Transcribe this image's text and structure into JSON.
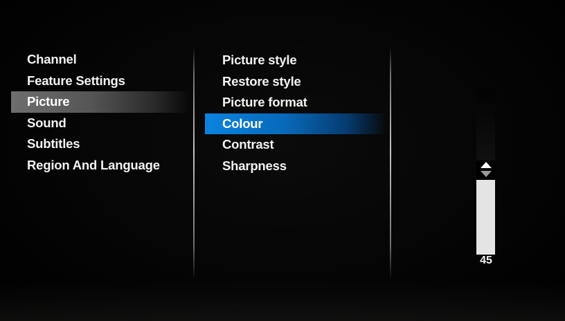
{
  "left_menu": {
    "items": [
      {
        "label": "Channel"
      },
      {
        "label": "Feature Settings"
      },
      {
        "label": "Picture"
      },
      {
        "label": "Sound"
      },
      {
        "label": "Subtitles"
      },
      {
        "label": "Region And Language"
      }
    ],
    "selected": "Picture"
  },
  "middle_menu": {
    "items": [
      {
        "label": "Picture style"
      },
      {
        "label": "Restore style"
      },
      {
        "label": "Picture format"
      },
      {
        "label": "Colour"
      },
      {
        "label": "Contrast"
      },
      {
        "label": "Sharpness"
      }
    ],
    "focused": "Colour"
  },
  "slider": {
    "value": "45",
    "min": 0,
    "max": 100,
    "fraction": 0.45
  },
  "colors": {
    "selected_bg": "#6e6e6e",
    "focus_blue": "#0a84e0",
    "slider_fill": "#e4e4e4",
    "text": "#f2f2f2"
  },
  "icons": {
    "increase": "arrow-up-icon",
    "decrease": "arrow-down-icon"
  }
}
